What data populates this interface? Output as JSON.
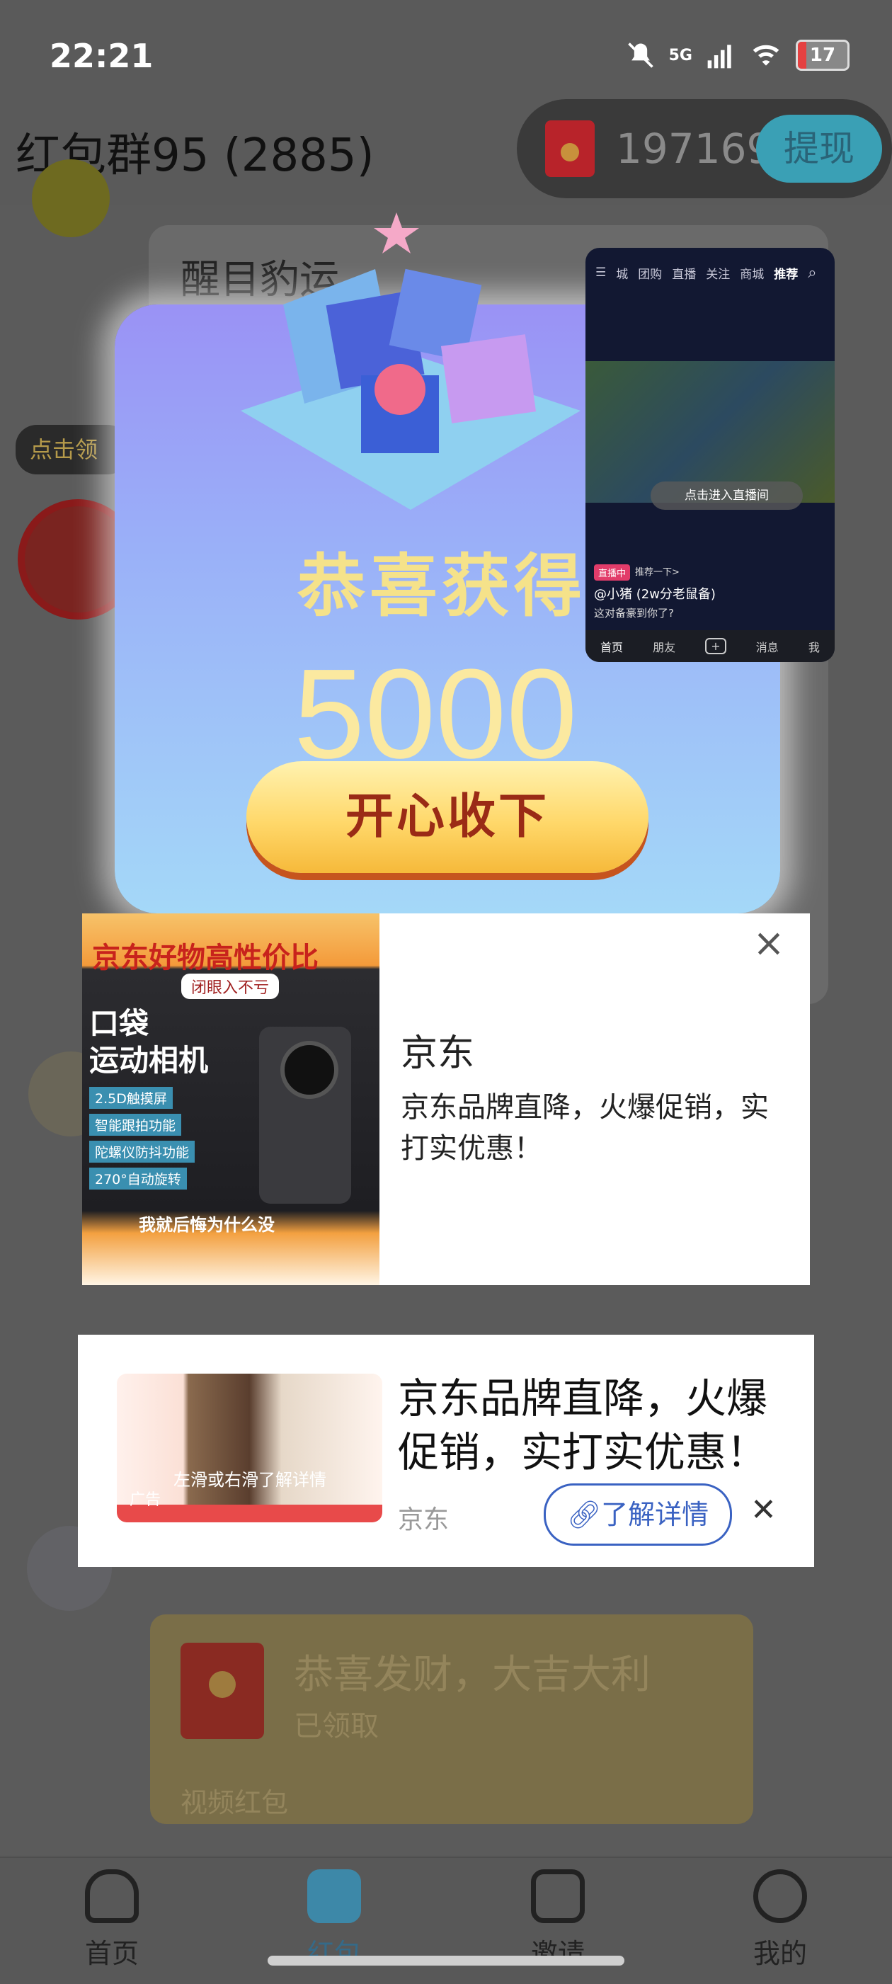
{
  "status_bar": {
    "time": "22:21",
    "network": "5G",
    "battery": "17"
  },
  "header": {
    "title": "红包群95 (2885)",
    "balance": "197169",
    "withdraw_label": "提现"
  },
  "chat": {
    "top_message": "醒目豹运",
    "claim_tag": "点击领",
    "bottom_message": {
      "title": "恭喜发财，大吉大利",
      "status": "已领取",
      "type": "视频红包"
    }
  },
  "reward_popup": {
    "congrats": "恭喜获得",
    "amount": "5000",
    "accept_label": "开心收下"
  },
  "pip_video": {
    "tabs": [
      "城",
      "团购",
      "直播",
      "关注",
      "商城",
      "推荐"
    ],
    "enter_live": "点击进入直播间",
    "live_badge": "直播中",
    "recommend": "推荐一下>",
    "user": "@小猪 (2w分老鼠备)",
    "caption": "这对备豪到你了?",
    "nav": [
      "首页",
      "朋友",
      "+",
      "消息",
      "我"
    ]
  },
  "ad_card_1": {
    "image_banner": "京东好物高性价比",
    "image_sub": "闭眼入不亏",
    "image_product": "口袋\n运动相机",
    "image_features": [
      "2.5D触摸屏",
      "智能跟拍功能",
      "陀螺仪防抖功能",
      "270°自动旋转"
    ],
    "image_bottom": "我就后悔为什么没",
    "brand": "京东",
    "description": "京东品牌直降，火爆促销，实打实优惠！"
  },
  "ad_card_2": {
    "image_text": "左滑或右滑了解详情",
    "ad_tag": "广告",
    "title": "京东品牌直降，火爆促销，实打实优惠！",
    "brand": "京东",
    "cta_label": "了解详情"
  },
  "bottom_nav": {
    "items": [
      {
        "label": "首页",
        "icon": "home-icon"
      },
      {
        "label": "红包",
        "icon": "red-envelope-icon"
      },
      {
        "label": "邀请",
        "icon": "invite-icon"
      },
      {
        "label": "我的",
        "icon": "profile-icon"
      }
    ]
  }
}
